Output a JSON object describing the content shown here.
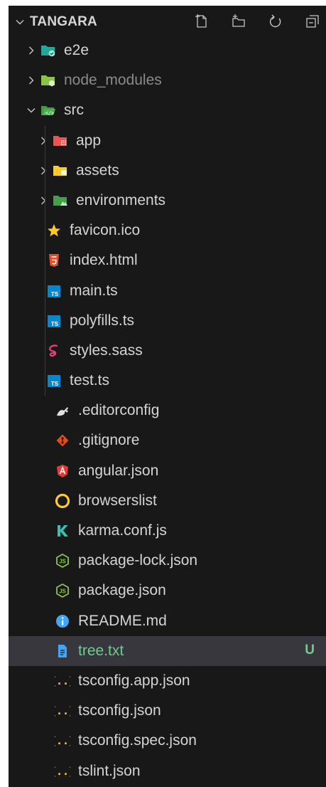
{
  "explorer": {
    "title": "TANGARA",
    "actions": [
      {
        "name": "new-file-icon"
      },
      {
        "name": "new-folder-icon"
      },
      {
        "name": "refresh-icon"
      },
      {
        "name": "collapse-all-icon"
      }
    ],
    "items": [
      {
        "label": "e2e",
        "depth": 1,
        "type": "folder",
        "expanded": false,
        "icon": "folder-e2e-icon",
        "color": "#26a69a"
      },
      {
        "label": "node_modules",
        "depth": 1,
        "type": "folder",
        "expanded": false,
        "icon": "folder-node-icon",
        "color": "#8bc34a",
        "dim": true
      },
      {
        "label": "src",
        "depth": 1,
        "type": "folder",
        "expanded": true,
        "icon": "folder-src-open-icon",
        "color": "#4caf50"
      },
      {
        "label": "app",
        "depth": 2,
        "type": "folder",
        "expanded": false,
        "icon": "folder-app-icon",
        "color": "#ef5350"
      },
      {
        "label": "assets",
        "depth": 2,
        "type": "folder",
        "expanded": false,
        "icon": "folder-assets-icon",
        "color": "#ffca28"
      },
      {
        "label": "environments",
        "depth": 2,
        "type": "folder",
        "expanded": false,
        "icon": "folder-environments-icon",
        "color": "#43a047"
      },
      {
        "label": "favicon.ico",
        "depth": 2,
        "type": "file",
        "icon": "star-icon",
        "color": "#ffca28"
      },
      {
        "label": "index.html",
        "depth": 2,
        "type": "file",
        "icon": "html5-icon",
        "color": "#e44d26"
      },
      {
        "label": "main.ts",
        "depth": 2,
        "type": "file",
        "icon": "typescript-icon",
        "color": "#0288d1"
      },
      {
        "label": "polyfills.ts",
        "depth": 2,
        "type": "file",
        "icon": "typescript-icon",
        "color": "#0288d1"
      },
      {
        "label": "styles.sass",
        "depth": 2,
        "type": "file",
        "icon": "sass-icon",
        "color": "#ec407a"
      },
      {
        "label": "test.ts",
        "depth": 2,
        "type": "file",
        "icon": "typescript-icon",
        "color": "#0288d1"
      },
      {
        "label": ".editorconfig",
        "depth": 1,
        "type": "file",
        "icon": "editorconfig-icon",
        "color": "#e0e0e0"
      },
      {
        "label": ".gitignore",
        "depth": 1,
        "type": "file",
        "icon": "git-icon",
        "color": "#e64a19"
      },
      {
        "label": "angular.json",
        "depth": 1,
        "type": "file",
        "icon": "angular-icon",
        "color": "#e53935"
      },
      {
        "label": "browserslist",
        "depth": 1,
        "type": "file",
        "icon": "browserslist-icon",
        "color": "#ffca28"
      },
      {
        "label": "karma.conf.js",
        "depth": 1,
        "type": "file",
        "icon": "karma-icon",
        "color": "#3cbeae"
      },
      {
        "label": "package-lock.json",
        "depth": 1,
        "type": "file",
        "icon": "nodejs-icon",
        "color": "#8bc34a"
      },
      {
        "label": "package.json",
        "depth": 1,
        "type": "file",
        "icon": "nodejs-icon",
        "color": "#8bc34a"
      },
      {
        "label": "README.md",
        "depth": 1,
        "type": "file",
        "icon": "info-icon",
        "color": "#42a5f5"
      },
      {
        "label": "tree.txt",
        "depth": 1,
        "type": "file",
        "icon": "text-file-icon",
        "color": "#42a5f5",
        "selected": true,
        "git_status": "U"
      },
      {
        "label": "tsconfig.app.json",
        "depth": 1,
        "type": "file",
        "icon": "json-braces-icon",
        "color": "#fbc02d"
      },
      {
        "label": "tsconfig.json",
        "depth": 1,
        "type": "file",
        "icon": "json-braces-icon",
        "color": "#fbc02d"
      },
      {
        "label": "tsconfig.spec.json",
        "depth": 1,
        "type": "file",
        "icon": "json-braces-icon",
        "color": "#fbc02d"
      },
      {
        "label": "tslint.json",
        "depth": 1,
        "type": "file",
        "icon": "json-braces-icon",
        "color": "#fbc02d"
      }
    ]
  }
}
